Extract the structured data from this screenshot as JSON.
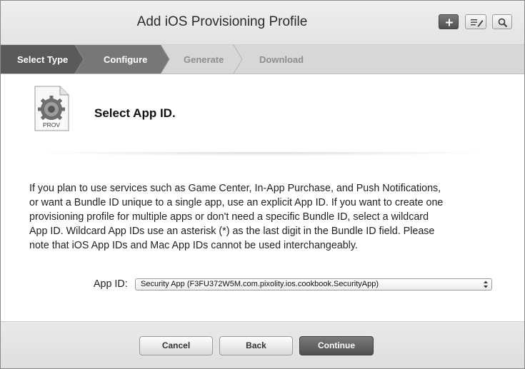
{
  "window": {
    "title": "Add iOS Provisioning Profile",
    "toolbar": {
      "add": "plus-icon",
      "edit": "edit-list-icon",
      "search": "search-icon"
    }
  },
  "steps": [
    {
      "label": "Select Type",
      "state": "done"
    },
    {
      "label": "Configure",
      "state": "current"
    },
    {
      "label": "Generate",
      "state": "pending"
    },
    {
      "label": "Download",
      "state": "pending"
    }
  ],
  "content": {
    "file_icon_label": "PROV",
    "heading": "Select App ID.",
    "paragraph_lines": [
      "If you plan to use services such as Game Center, In-App Purchase, and Push Notifications,",
      "or want a Bundle ID unique to a single app, use an explicit App ID. If you want to create one",
      "provisioning profile for multiple apps or don't need a specific Bundle ID, select a wildcard",
      "App ID. Wildcard App IDs use an asterisk (*) as the last digit in the Bundle ID field. Please",
      "note that iOS App IDs and Mac App IDs cannot be used interchangeably."
    ],
    "app_id_label": "App ID:",
    "app_id_selected": "Security App (F3FU372W5M.com.pixolity.ios.cookbook.SecurityApp)"
  },
  "footer": {
    "cancel": "Cancel",
    "back": "Back",
    "continue": "Continue"
  },
  "colors": {
    "step_done": "#5a5a5a",
    "step_current": "#777777",
    "step_pending": "#d7d7d7",
    "primary_button": "#5c5c5c"
  }
}
